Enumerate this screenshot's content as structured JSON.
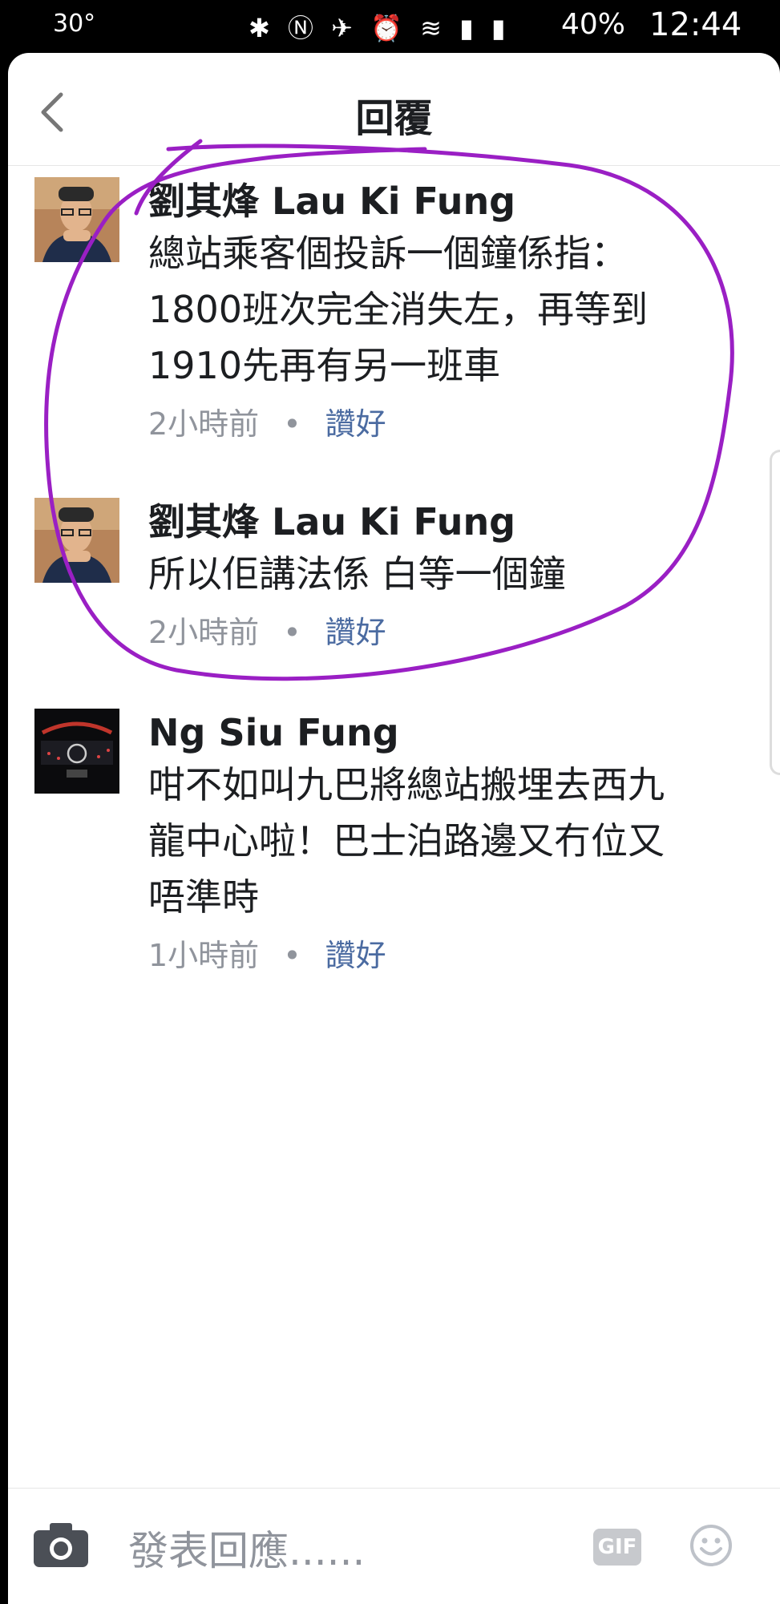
{
  "status_bar": {
    "temperature": "30°",
    "icons": "✱ Ⓝ ✈ ⏰ ≋ ▮ ▮",
    "battery": "40%",
    "time": "12:44"
  },
  "header": {
    "title": "回覆"
  },
  "comments": [
    {
      "author": "劉其烽 Lau Ki Fung",
      "lines": [
        "總站乘客個投訴一個鐘係指：",
        "1800班次完全消失左，再等到",
        "1910先再有另一班車"
      ],
      "time": "2小時前",
      "dot": "•",
      "like": "讚好"
    },
    {
      "author": "劉其烽 Lau Ki Fung",
      "lines": [
        "所以佢講法係 白等一個鐘"
      ],
      "time": "2小時前",
      "dot": "•",
      "like": "讚好"
    },
    {
      "author": "Ng Siu Fung",
      "lines": [
        "咁不如叫九巴將總站搬埋去西九",
        "龍中心啦！巴士泊路邊又冇位又",
        "唔準時"
      ],
      "time": "1小時前",
      "dot": "•",
      "like": "讚好"
    }
  ],
  "composer": {
    "placeholder": "發表回應......",
    "gif_label": "GIF"
  },
  "colors": {
    "annotation": "#9a1fc4",
    "like_link": "#4b6ba1",
    "meta": "#90949c"
  }
}
